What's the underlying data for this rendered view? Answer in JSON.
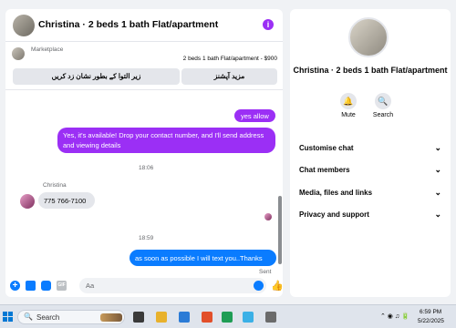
{
  "chat": {
    "title": "Christina · 2 beds 1 bath Flat/apartment",
    "marketplace": {
      "label": "Marketplace",
      "detail": "2 beds 1 bath Flat/apartment - $900",
      "button_left": "زیر التوا کے بطور نشان زد کریں",
      "button_right": "مزید آپشنز"
    },
    "messages": {
      "yes_allow": "yes allow",
      "reply": "Yes, it's available! Drop your contact number, and I'll send address and viewing details",
      "time1": "18:06",
      "sender": "Christina",
      "phone": "775 766-7100",
      "time2": "18:59",
      "last": "as soon as possible I will text you..Thanks",
      "sent": "Sent"
    },
    "composer": {
      "placeholder": "Aa",
      "gif": "GIF"
    }
  },
  "info": {
    "title": "Christina · 2 beds 1 bath Flat/apartment",
    "mute": "Mute",
    "search": "Search",
    "menu": [
      "Customise chat",
      "Chat members",
      "Media, files and links",
      "Privacy and support"
    ]
  },
  "taskbar": {
    "search": "Search",
    "time": "6:59 PM",
    "date": "5/22/2025",
    "apps": [
      "#3a3a3a",
      "#e8b12c",
      "#2b7bd6",
      "#e24f2a",
      "#1f9d55",
      "#3bb0e6",
      "#6b6b6b",
      "#c94040",
      "#d04f9a"
    ]
  },
  "colors": {
    "purple": "#9b2ff5",
    "blue": "#0a7cff",
    "gray_bubble": "#e4e6eb"
  },
  "icons": [
    "info-icon",
    "bell-icon",
    "search-icon",
    "chevron-down-icon",
    "plus-icon",
    "image-icon",
    "sticker-icon",
    "gif-icon",
    "emoji-icon",
    "like-icon",
    "windows-icon"
  ]
}
